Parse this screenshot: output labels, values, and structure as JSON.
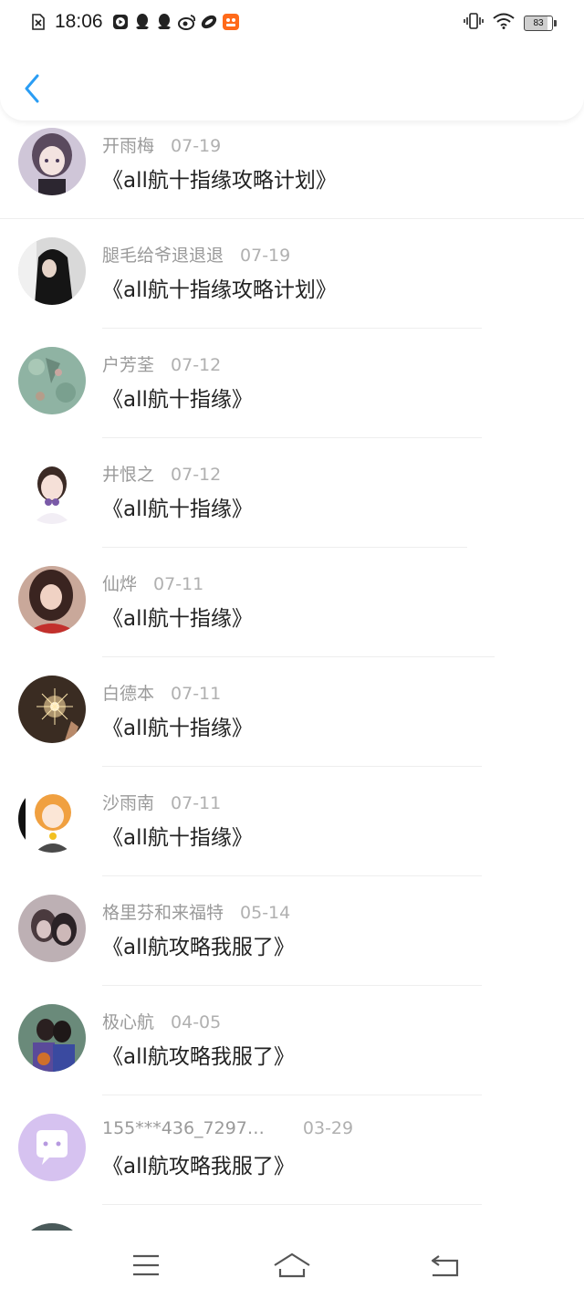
{
  "status_bar": {
    "time": "18:06",
    "battery": "83"
  },
  "header": {
    "back_icon": "chevron-left-icon",
    "accent": "#2a9df4"
  },
  "list": {
    "items": [
      {
        "name": "开雨梅",
        "date": "07-19",
        "title": "《all航十指缘攻略计划》"
      },
      {
        "name": "腿毛给爷退退退",
        "date": "07-19",
        "title": "《all航十指缘攻略计划》"
      },
      {
        "name": "户芳荃",
        "date": "07-12",
        "title": "《all航十指缘》"
      },
      {
        "name": "井恨之",
        "date": "07-12",
        "title": "《all航十指缘》"
      },
      {
        "name": "仙烨",
        "date": "07-11",
        "title": "《all航十指缘》"
      },
      {
        "name": "白德本",
        "date": "07-11",
        "title": "《all航十指缘》"
      },
      {
        "name": "沙雨南",
        "date": "07-11",
        "title": "《all航十指缘》"
      },
      {
        "name": "格里芬和来福特",
        "date": "05-14",
        "title": "《all航攻略我服了》"
      },
      {
        "name": "极心航",
        "date": "04-05",
        "title": "《all航攻略我服了》"
      },
      {
        "name": "155***436_7297…",
        "date": "03-29",
        "title": "《all航攻略我服了》"
      }
    ]
  },
  "navbar": {
    "menu_icon": "menu-icon",
    "home_icon": "home-icon",
    "back_icon": "return-icon"
  }
}
